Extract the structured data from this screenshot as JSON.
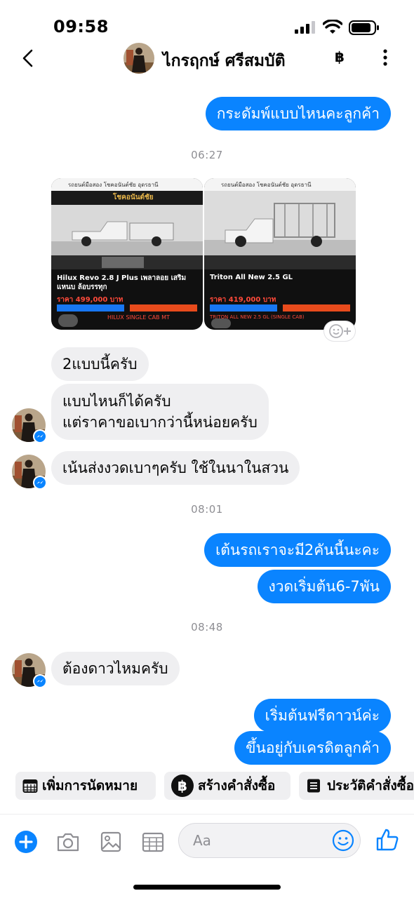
{
  "status_bar": {
    "time": "09:58"
  },
  "header": {
    "contact_name": "ไกรฤกษ์ ศรีสมบัติ",
    "baht_symbol": "฿"
  },
  "thread": {
    "msg_1": "กระดัมพ์แบบไหนคะลูกค้า",
    "time_1": "06:27",
    "photo_1": {
      "site_title": "รถยนต์มือสอง โชคอนันต์ชัย อุดรธานี",
      "logo": "โชคอนันต์ชัย",
      "model": "Hilux Revo 2.8 J Plus เพลาลอย เสริมแหนบ ล้อบรรทุก",
      "price": "ราคา 499,000 บาท",
      "footer": "HILUX SINGLE CAB MT"
    },
    "photo_2": {
      "site_title": "รถยนต์มือสอง โชคอนันต์ชัย อุดรธานี",
      "model": "Triton All New 2.5 GL",
      "price": "ราคา 419,000 บาท",
      "footer": "TRITON ALL NEW 2.5 GL (SINGLE CAB)"
    },
    "msg_2": "2แบบนี้ครับ",
    "msg_3_line1": "แบบไหนก็ได้ครับ",
    "msg_3_line2": "แต่ราคาขอเบากว่านี้หน่อยครับ",
    "msg_4": "เน้นส่งงวดเบาๆครับ ใช้ในนาในสวน",
    "time_2": "08:01",
    "msg_5": "เต้นรถเราจะมี2คันนี้นะคะ",
    "msg_6": "งวดเริ่มต้น6-7พัน",
    "time_3": "08:48",
    "msg_7": "ต้องดาวไหมครับ",
    "msg_8": "เริ่มต้นฟรีดาวน์ค่ะ",
    "msg_9": "ขึ้นอยู่กับเครดิตลูกค้า"
  },
  "shortcuts": {
    "appointment": "เพิ่มการนัดหมาย",
    "create_order": "สร้างคำสั่งซื้อ",
    "order_history": "ประวัติคำสั่งซื้อ"
  },
  "composer": {
    "placeholder": "Aa"
  },
  "colors": {
    "accent": "#0a84ff",
    "incoming_bubble": "#efeff1"
  }
}
